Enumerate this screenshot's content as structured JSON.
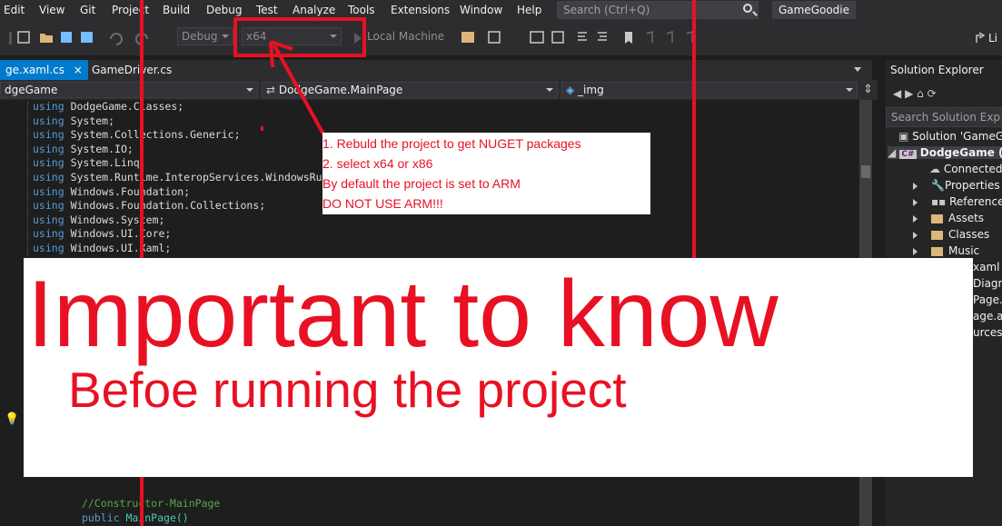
{
  "menu": [
    "Edit",
    "View",
    "Git",
    "Project",
    "Build",
    "Debug",
    "Test",
    "Analyze",
    "Tools",
    "Extensions",
    "Window",
    "Help"
  ],
  "search": {
    "placeholder": "Search (Ctrl+Q)"
  },
  "solution_name": "GameGoodie",
  "toolbar": {
    "config": "Debug",
    "platform": "x64",
    "run_target": "Local Machine",
    "live_share": "Li"
  },
  "tabs": [
    {
      "label": "ge.xaml.cs",
      "active": true
    },
    {
      "label": "GameDriver.cs",
      "active": false
    }
  ],
  "nav": {
    "project": "dgeGame",
    "class": "DodgeGame.MainPage",
    "member": "_img"
  },
  "code": [
    {
      "kw": "using",
      "ns": "DodgeGame.Classes;"
    },
    {
      "kw": "using",
      "ns": "System;"
    },
    {
      "kw": "using",
      "ns": "System.Collections.Generic;"
    },
    {
      "kw": "using",
      "ns": "System.IO;"
    },
    {
      "kw": "using",
      "ns": "System.Linq;"
    },
    {
      "kw": "using",
      "ns": "System.Runtime.InteropServices.WindowsRunt"
    },
    {
      "kw": "using",
      "ns": "Windows.Foundation;"
    },
    {
      "kw": "using",
      "ns": "Windows.Foundation.Collections;"
    },
    {
      "kw": "using",
      "ns": "Windows.System;"
    },
    {
      "kw": "using",
      "ns": "Windows.UI.Core;"
    },
    {
      "kw": "using",
      "ns": "Windows.UI.Xaml;"
    }
  ],
  "code_bottom": {
    "comment": "//Constructor-MainPage",
    "kw": "public",
    "name": "MainPage()"
  },
  "solution_explorer": {
    "title": "Solution Explorer",
    "search": "Search Solution Explore",
    "items": [
      "Solution 'GameGo",
      "DodgeGame (",
      "Connected",
      "Properties",
      "References",
      "Assets",
      "Classes",
      "Music"
    ],
    "partial_items": [
      "xaml",
      "Diagra",
      "Page.x",
      "age.ap",
      "urces.r"
    ]
  },
  "annotation": {
    "line1": "1. Rebuld the project to get NUGET packages",
    "line2": "2. select x64 or x86",
    "line3": "By default the project is set to ARM",
    "line4": "DO NOT USE ARM!!!"
  },
  "banner": {
    "title": "Important to know",
    "subtitle": "Befoe running the project"
  },
  "colors": {
    "accent": "#007acc",
    "annotation_red": "#e81123",
    "background": "#1e1e1e"
  }
}
